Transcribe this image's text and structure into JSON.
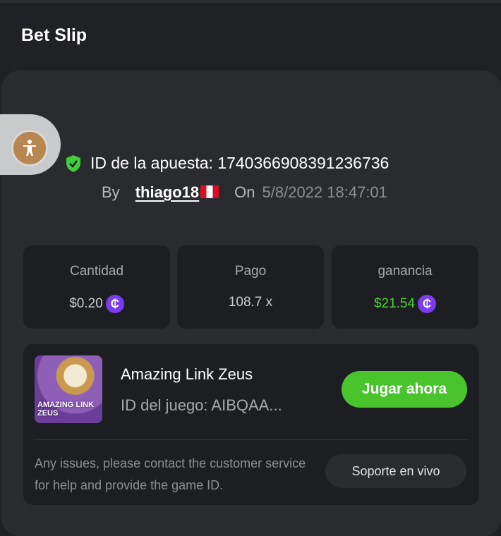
{
  "header": {
    "title": "Bet Slip"
  },
  "bet": {
    "id_label": "ID de la apuesta: 1740366908391236736",
    "by_label": "By",
    "username": "thiago18",
    "on_label": "On",
    "datetime": "5/8/2022 18:47:01"
  },
  "stats": [
    {
      "label": "Cantidad",
      "value": "$0.20",
      "coin": "₵"
    },
    {
      "label": "Pago",
      "value": "108.7 x"
    },
    {
      "label": "ganancia",
      "value": "$21.54",
      "coin": "₵"
    }
  ],
  "game": {
    "name": "Amazing Link Zeus",
    "id_text": "ID del juego: AIBQAA...",
    "thumb_text": "AMAZING LINK ZEUS",
    "play_label": "Jugar ahora"
  },
  "support": {
    "message": "Any issues, please contact the customer service for help and provide the game ID.",
    "button_label": "Soporte en vivo"
  },
  "colors": {
    "accent_green": "#4ac42d",
    "win_green": "#4fd136",
    "coin_purple": "#7b3cf0",
    "background": "#202124"
  },
  "icons": [
    "accessibility-icon",
    "shield-check-icon",
    "peru-flag-icon",
    "coin-icon"
  ]
}
